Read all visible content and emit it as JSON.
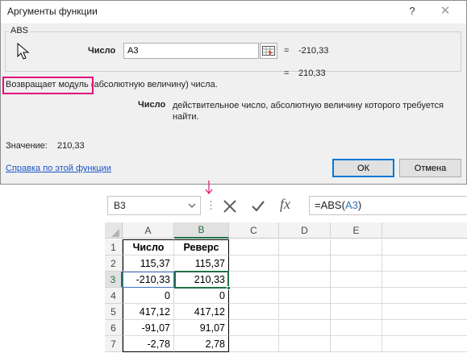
{
  "dialog": {
    "title": "Аргументы функции",
    "help_icon": "question-mark",
    "close_icon": "close-x",
    "function_name": "ABS",
    "arg_label": "Число",
    "arg_value": "A3",
    "arg_eval_eq": "=",
    "arg_eval": "-210,33",
    "result_eq": "=",
    "result": "210,33",
    "description": "Возвращает модуль (абсолютную величину) числа.",
    "arg_desc_name": "Число",
    "arg_desc_text": "действительное число, абсолютную величину которого требуется найти.",
    "value_label": "Значение:",
    "value": "210,33",
    "help_link": "Справка по этой функции",
    "ok_label": "ОК",
    "cancel_label": "Отмена",
    "highlight_color": "#e2117a"
  },
  "formula_bar": {
    "name_box": "B3",
    "dots": "⋮",
    "fx": "fx",
    "formula_prefix": "=ABS(",
    "formula_ref": "A3",
    "formula_suffix": ")"
  },
  "sheet": {
    "columns": [
      "A",
      "B",
      "C",
      "D",
      "E"
    ],
    "active_column": "B",
    "active_row": "3",
    "rows": [
      {
        "num": "1",
        "a": "Число",
        "b": "Реверс"
      },
      {
        "num": "2",
        "a": "115,37",
        "b": "115,37"
      },
      {
        "num": "3",
        "a": "-210,33",
        "b": "210,33"
      },
      {
        "num": "4",
        "a": "0",
        "b": "0"
      },
      {
        "num": "5",
        "a": "417,12",
        "b": "417,12"
      },
      {
        "num": "6",
        "a": "-91,07",
        "b": "91,07"
      },
      {
        "num": "7",
        "a": "-2,78",
        "b": "2,78"
      }
    ],
    "accent_color": "#217346"
  }
}
